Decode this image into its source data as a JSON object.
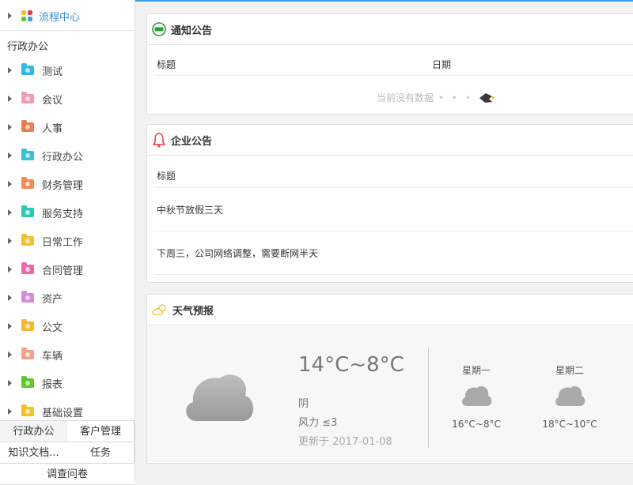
{
  "sidebar": {
    "flow_center": "流程中心",
    "section_title": "行政办公",
    "items": [
      {
        "label": "测试",
        "icon": "test-cube-icon",
        "color": "#2fb8e8"
      },
      {
        "label": "会议",
        "icon": "folder-meeting-icon",
        "color": "#f29ab8"
      },
      {
        "label": "人事",
        "icon": "folder-hr-icon",
        "color": "#f07a4a"
      },
      {
        "label": "行政办公",
        "icon": "folder-admin-icon",
        "color": "#37c0d6"
      },
      {
        "label": "财务管理",
        "icon": "folder-finance-icon",
        "color": "#f08a5a"
      },
      {
        "label": "服务支持",
        "icon": "folder-support-icon",
        "color": "#2cc9b0"
      },
      {
        "label": "日常工作",
        "icon": "folder-daily-icon",
        "color": "#f4c02a"
      },
      {
        "label": "合同管理",
        "icon": "folder-contract-icon",
        "color": "#e86aa6"
      },
      {
        "label": "资产",
        "icon": "folder-asset-icon",
        "color": "#d68ad8"
      },
      {
        "label": "公文",
        "icon": "folder-document-icon",
        "color": "#f4b92a"
      },
      {
        "label": "车辆",
        "icon": "folder-vehicle-icon",
        "color": "#f4a08a"
      },
      {
        "label": "报表",
        "icon": "folder-report-icon",
        "color": "#5cc92a"
      },
      {
        "label": "基础设置",
        "icon": "folder-settings-icon",
        "color": "#f4c02a"
      }
    ],
    "tabs": [
      "行政办公",
      "客户管理",
      "知识文档...",
      "任务",
      "调查问卷"
    ]
  },
  "notice": {
    "title": "通知公告",
    "col_title": "标题",
    "col_date": "日期",
    "empty_text": "当前没有数据",
    "dots": "• • •"
  },
  "enterprise": {
    "title": "企业公告",
    "col_title": "标题",
    "rows": [
      "中秋节放假三天",
      "下周三，公司网络调整，需要断网半天"
    ]
  },
  "weather": {
    "title": "天气预报",
    "today_temp": "14°C~8°C",
    "today_cond": "阴",
    "today_wind": "风力 ≤3",
    "updated": "更新于 2017-01-08",
    "days": [
      {
        "name": "星期一",
        "temp": "16°C~8°C"
      },
      {
        "name": "星期二",
        "temp": "18°C~10°C"
      }
    ]
  },
  "colors": {
    "accent": "#3d9ee6",
    "notice_icon": "#2a9a3a",
    "bell": "#e8394a",
    "sun": "#f4c02a"
  }
}
